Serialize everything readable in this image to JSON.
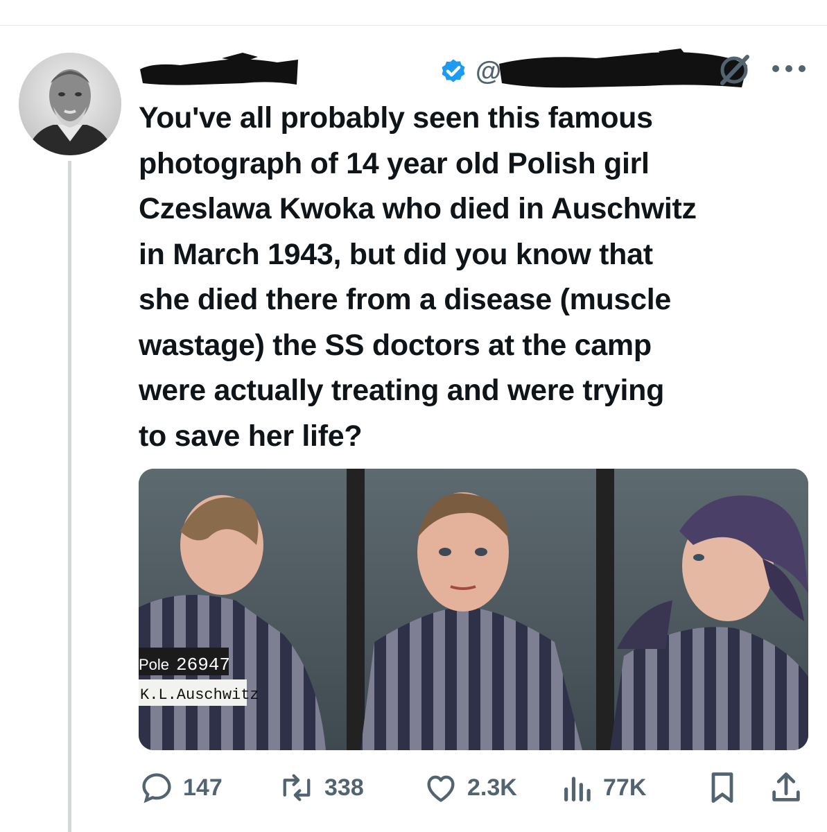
{
  "tweet": {
    "handle_prefix": "@",
    "text": "You've all probably seen this famous\nphotograph of 14 year old Polish girl\nCzeslawa Kwoka who died in Auschwitz\nin March 1943, but did you know that\nshe died there from a disease (muscle\nwastage) the SS doctors at the camp\nwere actually treating and were trying\nto save her life?",
    "image_sign": {
      "label_pole": "Pole",
      "number": "26947",
      "camp": "K.L.Auschwitz"
    },
    "actions": {
      "replies": "147",
      "reposts": "338",
      "likes": "2.3K",
      "views": "77K"
    }
  },
  "colors": {
    "verified": "#1d9bf0",
    "secondary_text": "#536471",
    "thread_line": "#d5d8db"
  },
  "icons": [
    "verified-badge-icon",
    "grok-icon",
    "more-options-icon",
    "reply-icon",
    "repost-icon",
    "like-icon",
    "views-icon",
    "bookmark-icon",
    "share-icon"
  ]
}
